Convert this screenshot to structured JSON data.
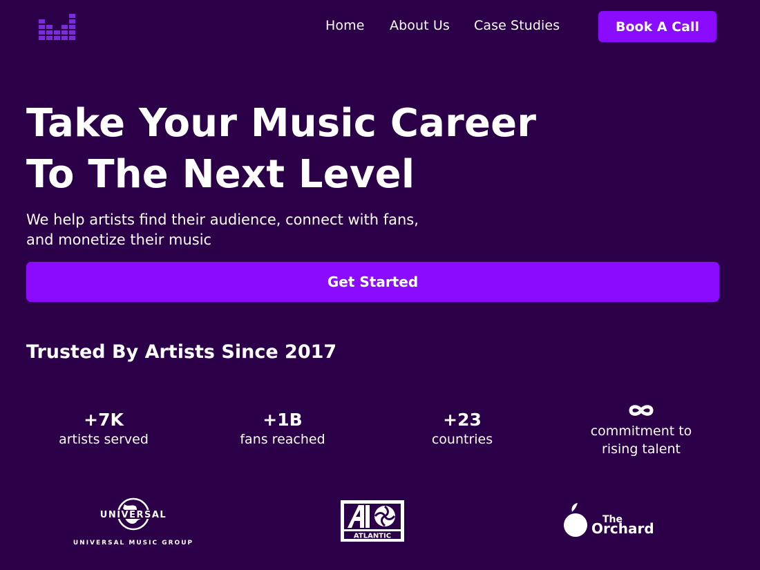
{
  "nav": {
    "links": [
      "Home",
      "About Us",
      "Case Studies"
    ],
    "cta": "Book A Call"
  },
  "hero": {
    "title_line1": "Take Your Music Career",
    "title_line2": "To The Next Level",
    "subtitle_line1": "We help artists find their audience, connect with fans,",
    "subtitle_line2": "and monetize their music",
    "cta": "Get Started"
  },
  "trusted": {
    "heading": "Trusted By Artists Since 2017",
    "stats": [
      {
        "value": "+7K",
        "label": "artists served"
      },
      {
        "value": "+1B",
        "label": "fans reached"
      },
      {
        "value": "+23",
        "label": "countries"
      },
      {
        "value": "infinity-icon",
        "label_line1": "commitment to",
        "label_line2": "rising talent"
      }
    ]
  },
  "partners": {
    "universal_word": "UNIVERSAL",
    "universal_sub": "UNIVERSAL MUSIC GROUP",
    "atlantic_word": "ATLANTIC",
    "orchard_the": "The",
    "orchard_word": "Orchard"
  },
  "colors": {
    "background": "#2b0049",
    "accent": "#8a0bff",
    "logo": "#7a2cd9",
    "text": "#ffffff"
  },
  "icons": [
    "equalizer-logo-icon",
    "infinity-icon",
    "globe-icon",
    "peach-icon"
  ]
}
